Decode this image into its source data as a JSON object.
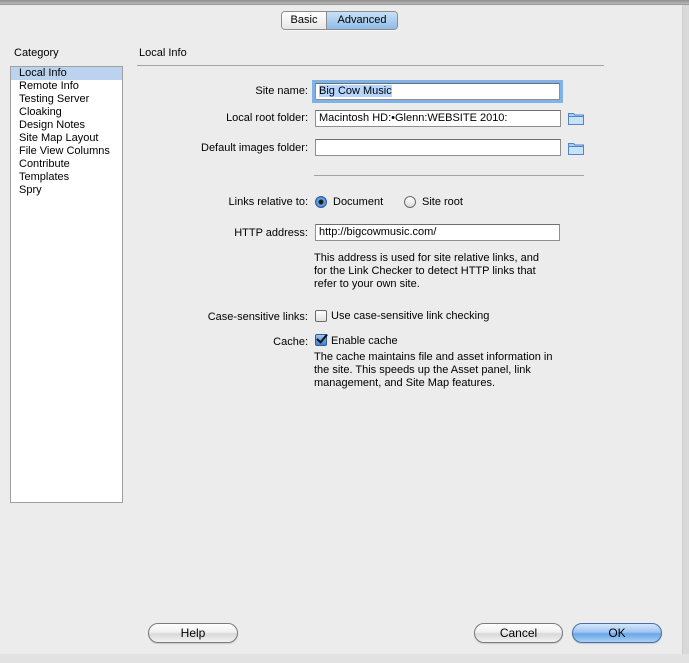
{
  "segmented": {
    "basic_label": "Basic",
    "advanced_label": "Advanced"
  },
  "sidebar": {
    "heading": "Category",
    "items": [
      {
        "label": "Local Info"
      },
      {
        "label": "Remote Info"
      },
      {
        "label": "Testing Server"
      },
      {
        "label": "Cloaking"
      },
      {
        "label": "Design Notes"
      },
      {
        "label": "Site Map Layout"
      },
      {
        "label": "File View Columns"
      },
      {
        "label": "Contribute"
      },
      {
        "label": "Templates"
      },
      {
        "label": "Spry"
      }
    ],
    "selected_index": 0
  },
  "main": {
    "section_title": "Local Info",
    "site_name": {
      "label": "Site name:",
      "value": "Big Cow Music"
    },
    "local_root": {
      "label": "Local root folder:",
      "value": "Macintosh HD:•Glenn:WEBSITE 2010:"
    },
    "default_images": {
      "label": "Default images folder:",
      "value": ""
    },
    "links_relative": {
      "label": "Links relative to:",
      "options": [
        "Document",
        "Site root"
      ],
      "selected": "Document"
    },
    "http_address": {
      "label": "HTTP address:",
      "value": "http://bigcowmusic.com/",
      "help": "This address is used for site relative links, and\nfor the Link Checker to detect HTTP links that\nrefer to your own site."
    },
    "case_sensitive": {
      "label": "Case-sensitive links:",
      "checkbox_label": "Use case-sensitive link checking",
      "checked": false
    },
    "cache": {
      "label": "Cache:",
      "checkbox_label": "Enable cache",
      "checked": true,
      "help": "The cache maintains file and asset information in\nthe site.  This speeds up the Asset panel, link\nmanagement, and Site Map features."
    }
  },
  "footer": {
    "help_label": "Help",
    "cancel_label": "Cancel",
    "ok_label": "OK"
  },
  "icons": {
    "folder": "folder-icon"
  },
  "colors": {
    "selection": "#bcd3ef",
    "accent": "#6aa6e8"
  }
}
